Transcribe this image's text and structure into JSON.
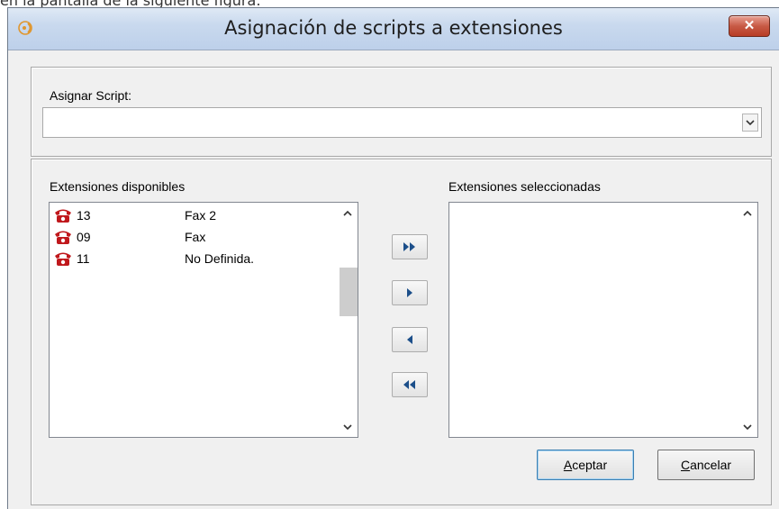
{
  "caption": "en la pantalla de la siguiente figura:",
  "window": {
    "title": "Asignación de scripts a extensiones",
    "close_glyph": "✕"
  },
  "assign": {
    "label": "Asignar Script:",
    "selected_value": ""
  },
  "available": {
    "label": "Extensiones disponibles",
    "items": [
      {
        "ext": "13",
        "name": "Fax 2",
        "icon": "phone-icon"
      },
      {
        "ext": "09",
        "name": "Fax",
        "icon": "phone-icon"
      },
      {
        "ext": "11",
        "name": "No Definida.",
        "icon": "phone-icon"
      }
    ]
  },
  "selected": {
    "label": "Extensiones seleccionadas",
    "items": []
  },
  "transfer_buttons": [
    "add-all",
    "add-one",
    "remove-one",
    "remove-all"
  ],
  "buttons": {
    "accept_first": "A",
    "accept_rest": "ceptar",
    "cancel_first": "C",
    "cancel_rest": "ancelar"
  },
  "colors": {
    "phone": "#c0181c",
    "arrow": "#1c4f8a",
    "close": "#c75a45"
  }
}
